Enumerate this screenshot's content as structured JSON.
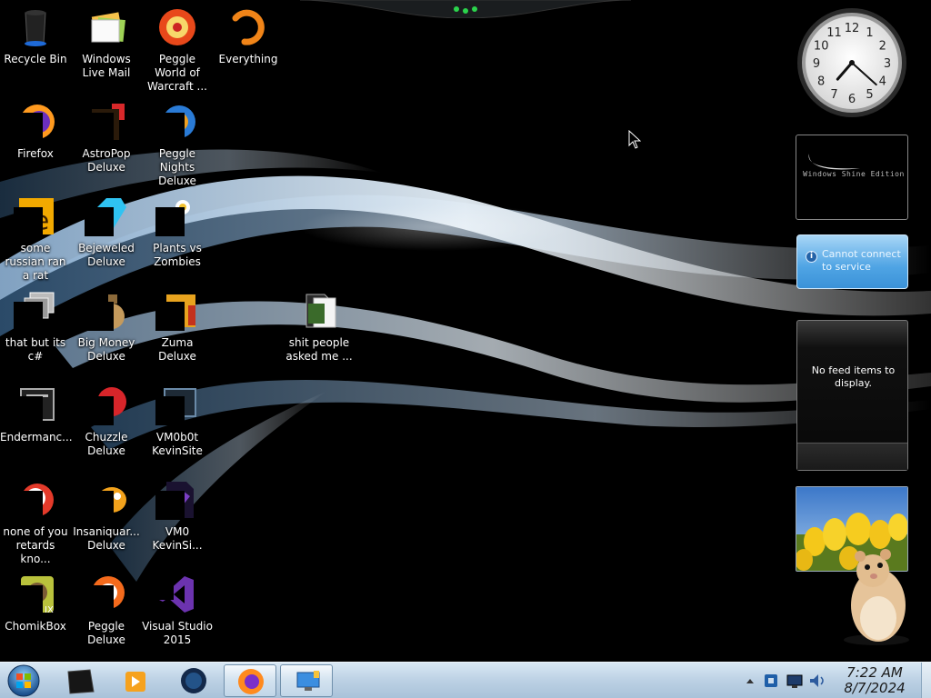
{
  "desktop": {
    "icons": [
      {
        "label": "Recycle Bin",
        "icon": "recycle-bin-icon"
      },
      {
        "label": "Windows Live Mail",
        "icon": "mail-icon"
      },
      {
        "label": "Peggle World of Warcraft ...",
        "icon": "peggle-icon"
      },
      {
        "label": "Everything",
        "icon": "everything-icon"
      },
      {
        "label": "Firefox",
        "icon": "firefox-icon"
      },
      {
        "label": "AstroPop Deluxe",
        "icon": "game-icon"
      },
      {
        "label": "Peggle Nights Deluxe",
        "icon": "peggle-icon"
      },
      {
        "label": "some russian ran a rat",
        "icon": "app-icon"
      },
      {
        "label": "Bejeweled Deluxe",
        "icon": "gem-icon"
      },
      {
        "label": "Plants vs Zombies",
        "icon": "flower-icon"
      },
      {
        "label": "that but its c#",
        "icon": "windows-icon"
      },
      {
        "label": "Big Money Deluxe",
        "icon": "money-bag-icon"
      },
      {
        "label": "Zuma Deluxe",
        "icon": "game-icon"
      },
      {
        "label": "Endermanc...",
        "icon": "console-icon"
      },
      {
        "label": "Chuzzle Deluxe",
        "icon": "game-icon"
      },
      {
        "label": "VM0b0t KevinSite",
        "icon": "vm-icon"
      },
      {
        "label": "none of you retards kno...",
        "icon": "peggle-icon"
      },
      {
        "label": "Insaniquar... Deluxe",
        "icon": "fish-icon"
      },
      {
        "label": "VM0 KevinSi...",
        "icon": "document-icon"
      },
      {
        "label": "ChomikBox",
        "icon": "hamster-icon"
      },
      {
        "label": "Peggle Deluxe",
        "icon": "peggle-icon"
      },
      {
        "label": "Visual Studio 2015",
        "icon": "visual-studio-icon"
      },
      {
        "label": "shit people asked me ...",
        "icon": "folder-icon"
      }
    ]
  },
  "gadgets": {
    "clock": {
      "numbers": [
        "12",
        "1",
        "2",
        "3",
        "4",
        "5",
        "6",
        "7",
        "8",
        "9",
        "10",
        "11"
      ],
      "hour": 7,
      "minute": 22
    },
    "logo": {
      "text": "Windows Shine Edition"
    },
    "service": {
      "message": "Cannot connect to service"
    },
    "feed": {
      "message": "No feed items to display."
    }
  },
  "taskbar": {
    "time": "7:22 AM",
    "date": "8/7/2024",
    "buttons": [
      {
        "name": "start-button",
        "icon": "windows-orb-icon"
      },
      {
        "name": "taskbar-app-1",
        "icon": "terminal-icon"
      },
      {
        "name": "taskbar-media-player",
        "icon": "media-player-icon"
      },
      {
        "name": "taskbar-globe",
        "icon": "globe-icon"
      },
      {
        "name": "taskbar-firefox",
        "icon": "firefox-icon"
      },
      {
        "name": "taskbar-remote-desktop",
        "icon": "remote-desktop-icon"
      }
    ]
  },
  "colors": {
    "taskbar": "#bcd1e4",
    "service_gadget": "#4fa4e4",
    "text": "#ffffff"
  }
}
